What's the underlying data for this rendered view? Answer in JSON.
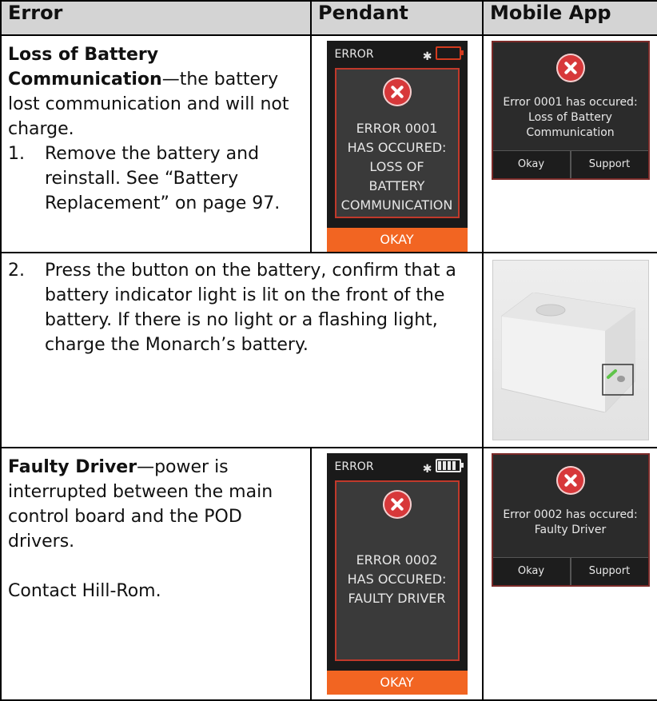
{
  "headers": {
    "error": "Error",
    "pendant": "Pendant",
    "mobile": "Mobile App"
  },
  "row1": {
    "title": "Loss of Battery Communication",
    "desc": "—the battery lost communication and will not charge.",
    "step_num": "1.",
    "step_text": "Remove the battery and reinstall. See “Battery Replacement” on page 97.",
    "pendant": {
      "bar_label": "ERROR",
      "lines": [
        "ERROR 0001",
        "HAS OCCURED:",
        "LOSS OF",
        "BATTERY",
        "COMMUNICATION"
      ],
      "okay": "OKAY",
      "battery_state": "empty-red"
    },
    "app": {
      "message_line1": "Error 0001 has occured:",
      "message_line2": "Loss of Battery",
      "message_line3": "Communication",
      "okay": "Okay",
      "support": "Support"
    }
  },
  "row2": {
    "step_num": "2.",
    "step_text": "Press the button on the battery, confirm that a battery indicator light is lit on the front of the battery. If there is no light or a flashing light, charge the Monarch’s battery."
  },
  "row3": {
    "title": "Faulty Driver",
    "desc": "—power is interrupted between the main control board and the POD drivers.",
    "contact": "Contact Hill-Rom.",
    "pendant": {
      "bar_label": "ERROR",
      "lines": [
        "ERROR 0002",
        "HAS OCCURED:",
        "FAULTY DRIVER"
      ],
      "okay": "OKAY",
      "battery_state": "full"
    },
    "app": {
      "message_line1": "Error 0002 has occured:",
      "message_line2": "Faulty Driver",
      "okay": "Okay",
      "support": "Support"
    }
  },
  "colors": {
    "error_red": "#d7383a",
    "okay_orange": "#f26522",
    "header_gray": "#d4d4d4"
  },
  "icons": [
    "error-x-icon",
    "bluetooth-icon",
    "battery-icon"
  ]
}
